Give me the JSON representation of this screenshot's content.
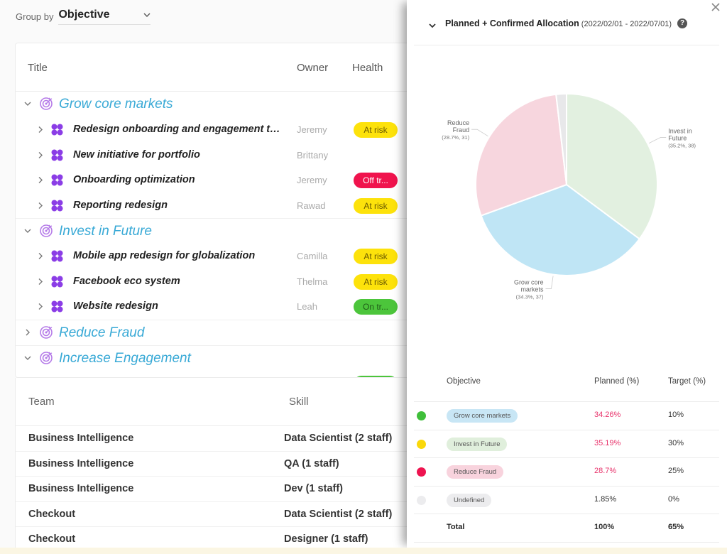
{
  "group_by": {
    "label": "Group by",
    "value": "Objective"
  },
  "objectives_table": {
    "columns": {
      "title": "Title",
      "owner": "Owner",
      "health": "Health"
    },
    "groups": [
      {
        "name": "Grow core markets",
        "expanded": true,
        "items": [
          {
            "title": "Redesign onboarding and engagement to ...",
            "owner": "Jeremy",
            "health": "At risk",
            "health_status": "at-risk"
          },
          {
            "title": "New initiative for portfolio",
            "owner": "Brittany",
            "health": "",
            "health_status": "none"
          },
          {
            "title": "Onboarding optimization",
            "owner": "Jeremy",
            "health": "Off tr...",
            "health_status": "off-track"
          },
          {
            "title": "Reporting redesign",
            "owner": "Rawad",
            "health": "At risk",
            "health_status": "at-risk"
          }
        ]
      },
      {
        "name": "Invest in Future",
        "expanded": true,
        "items": [
          {
            "title": "Mobile app redesign for globalization",
            "owner": "Camilla",
            "health": "At risk",
            "health_status": "at-risk"
          },
          {
            "title": "Facebook eco system",
            "owner": "Thelma",
            "health": "At risk",
            "health_status": "at-risk"
          },
          {
            "title": "Website redesign",
            "owner": "Leah",
            "health": "On tr...",
            "health_status": "on-track"
          }
        ]
      },
      {
        "name": "Reduce Fraud",
        "expanded": false,
        "items": []
      },
      {
        "name": "Increase Engagement",
        "expanded": true,
        "items": [
          {
            "title": "",
            "owner": "",
            "health": "",
            "health_status": "on-track",
            "partial": true
          }
        ]
      }
    ]
  },
  "team_table": {
    "columns": {
      "team": "Team",
      "skill": "Skill"
    },
    "rows": [
      {
        "team": "Business Intelligence",
        "skill": "Data Scientist (2 staff)"
      },
      {
        "team": "Business Intelligence",
        "skill": "QA (1 staff)"
      },
      {
        "team": "Business Intelligence",
        "skill": "Dev (1 staff)"
      },
      {
        "team": "Checkout",
        "skill": "Data Scientist (2 staff)"
      },
      {
        "team": "Checkout",
        "skill": "Designer (1 staff)"
      }
    ]
  },
  "status_colors": {
    "at-risk": {
      "bg": "#fde20b",
      "fg": "#6b5a00"
    },
    "off-track": {
      "bg": "#f0134d",
      "fg": "#ffffff"
    },
    "on-track": {
      "bg": "#4cc53b",
      "fg": "#1f5a18"
    },
    "none": {
      "bg": "transparent",
      "fg": "transparent"
    }
  },
  "drawer": {
    "title": "Planned + Confirmed Allocation",
    "date_range": "(2022/02/01 - 2022/07/01)",
    "help_icon": "?",
    "close_icon": "close-icon"
  },
  "chart_data": {
    "type": "pie",
    "title": "Planned + Confirmed Allocation",
    "start": "top, clockwise",
    "slices": [
      {
        "name": "Invest in Future",
        "label_lines": [
          "Invest in",
          "Future"
        ],
        "percent": 35.2,
        "value": 38,
        "color": "#e2f0e0"
      },
      {
        "name": "Grow core markets",
        "label_lines": [
          "Grow core",
          "markets"
        ],
        "percent": 34.3,
        "value": 37,
        "color": "#bfe5f5"
      },
      {
        "name": "Reduce Fraud",
        "label_lines": [
          "Reduce",
          "Fraud"
        ],
        "percent": 28.7,
        "value": 31,
        "color": "#f7d6de"
      },
      {
        "name": "Undefined",
        "label_lines": [],
        "percent": 1.85,
        "value": 2,
        "color": "#e8e8ea"
      }
    ]
  },
  "allocation_table": {
    "columns": {
      "objective": "Objective",
      "planned": "Planned (%)",
      "target": "Target (%)"
    },
    "rows": [
      {
        "objective": "Grow core markets",
        "planned": "34.26%",
        "target": "10%",
        "dot_color": "#3fbf3a",
        "pill_color": "#c8e6f5",
        "planned_over": true
      },
      {
        "objective": "Invest in Future",
        "planned": "35.19%",
        "target": "30%",
        "dot_color": "#fad80a",
        "pill_color": "#e0efdc",
        "planned_over": true
      },
      {
        "objective": "Reduce Fraud",
        "planned": "28.7%",
        "target": "25%",
        "dot_color": "#ee1450",
        "pill_color": "#f8d3dd",
        "planned_over": true
      },
      {
        "objective": "Undefined",
        "planned": "1.85%",
        "target": "0%",
        "dot_color": "#ececee",
        "pill_color": "#ececee",
        "planned_over": false
      }
    ],
    "total": {
      "label": "Total",
      "planned": "100%",
      "target": "65%"
    }
  }
}
